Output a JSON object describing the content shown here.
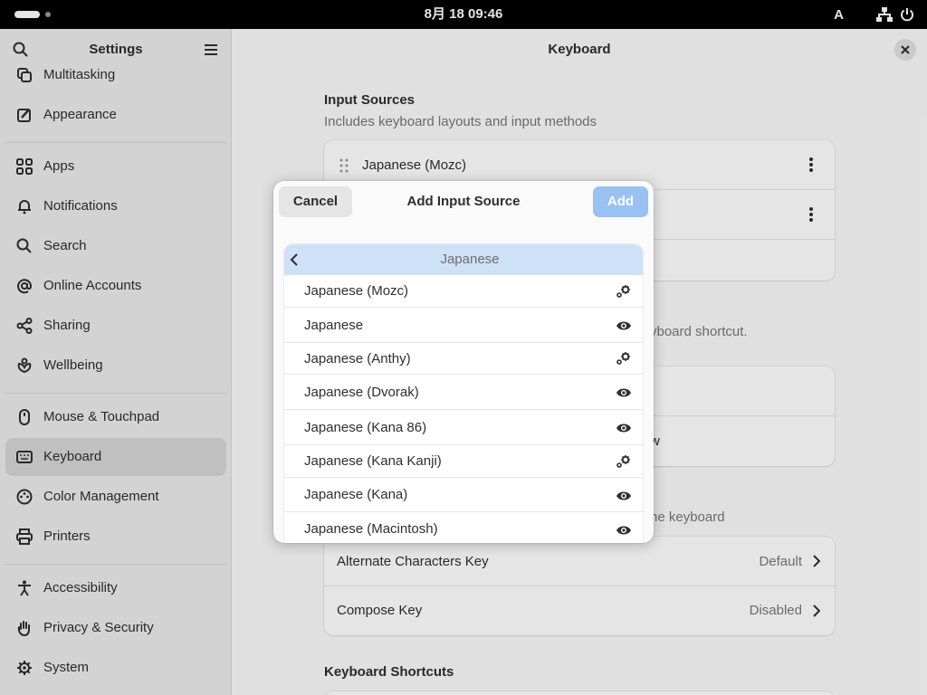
{
  "topbar": {
    "date_time": "8月 18  09:46",
    "input_indicator": "A"
  },
  "sidebar": {
    "title": "Settings",
    "items": [
      {
        "label": "Multitasking",
        "icon": "multitasking-icon"
      },
      {
        "label": "Appearance",
        "icon": "appearance-icon"
      },
      {
        "label": "Apps",
        "icon": "apps-icon"
      },
      {
        "label": "Notifications",
        "icon": "bell-icon"
      },
      {
        "label": "Search",
        "icon": "search-icon"
      },
      {
        "label": "Online Accounts",
        "icon": "at-icon"
      },
      {
        "label": "Sharing",
        "icon": "share-icon"
      },
      {
        "label": "Wellbeing",
        "icon": "wellbeing-icon"
      },
      {
        "label": "Mouse & Touchpad",
        "icon": "mouse-icon"
      },
      {
        "label": "Keyboard",
        "icon": "keyboard-icon",
        "selected": true
      },
      {
        "label": "Color Management",
        "icon": "color-icon"
      },
      {
        "label": "Printers",
        "icon": "printer-icon"
      },
      {
        "label": "Accessibility",
        "icon": "accessibility-icon"
      },
      {
        "label": "Privacy & Security",
        "icon": "hand-icon"
      },
      {
        "label": "System",
        "icon": "gear-icon"
      }
    ]
  },
  "main": {
    "title": "Keyboard",
    "input_sources": {
      "title": "Input Sources",
      "subtitle": "Includes keyboard layouts and input methods",
      "first_source": "Japanese (Mozc)"
    },
    "partial_texts": {
      "shortcut_hint": "yboard shortcut.",
      "window_text": "w",
      "keyboard_hint": "he keyboard"
    },
    "special_chars": {
      "rows": [
        {
          "label": "Alternate Characters Key",
          "value": "Default"
        },
        {
          "label": "Compose Key",
          "value": "Disabled"
        }
      ]
    },
    "shortcuts_title": "Keyboard Shortcuts"
  },
  "dialog": {
    "title": "Add Input Source",
    "cancel_label": "Cancel",
    "add_label": "Add",
    "language_header": "Japanese",
    "sources": [
      {
        "label": "Japanese (Mozc)",
        "icon": "settings-icon"
      },
      {
        "label": "Japanese",
        "icon": "eye-icon"
      },
      {
        "label": "Japanese (Anthy)",
        "icon": "settings-icon"
      },
      {
        "label": "Japanese (Dvorak)",
        "icon": "eye-icon"
      },
      {
        "label": "Japanese (Kana 86)",
        "icon": "eye-icon"
      },
      {
        "label": "Japanese (Kana Kanji)",
        "icon": "settings-icon"
      },
      {
        "label": "Japanese (Kana)",
        "icon": "eye-icon"
      },
      {
        "label": "Japanese (Macintosh)",
        "icon": "eye-icon"
      }
    ]
  }
}
